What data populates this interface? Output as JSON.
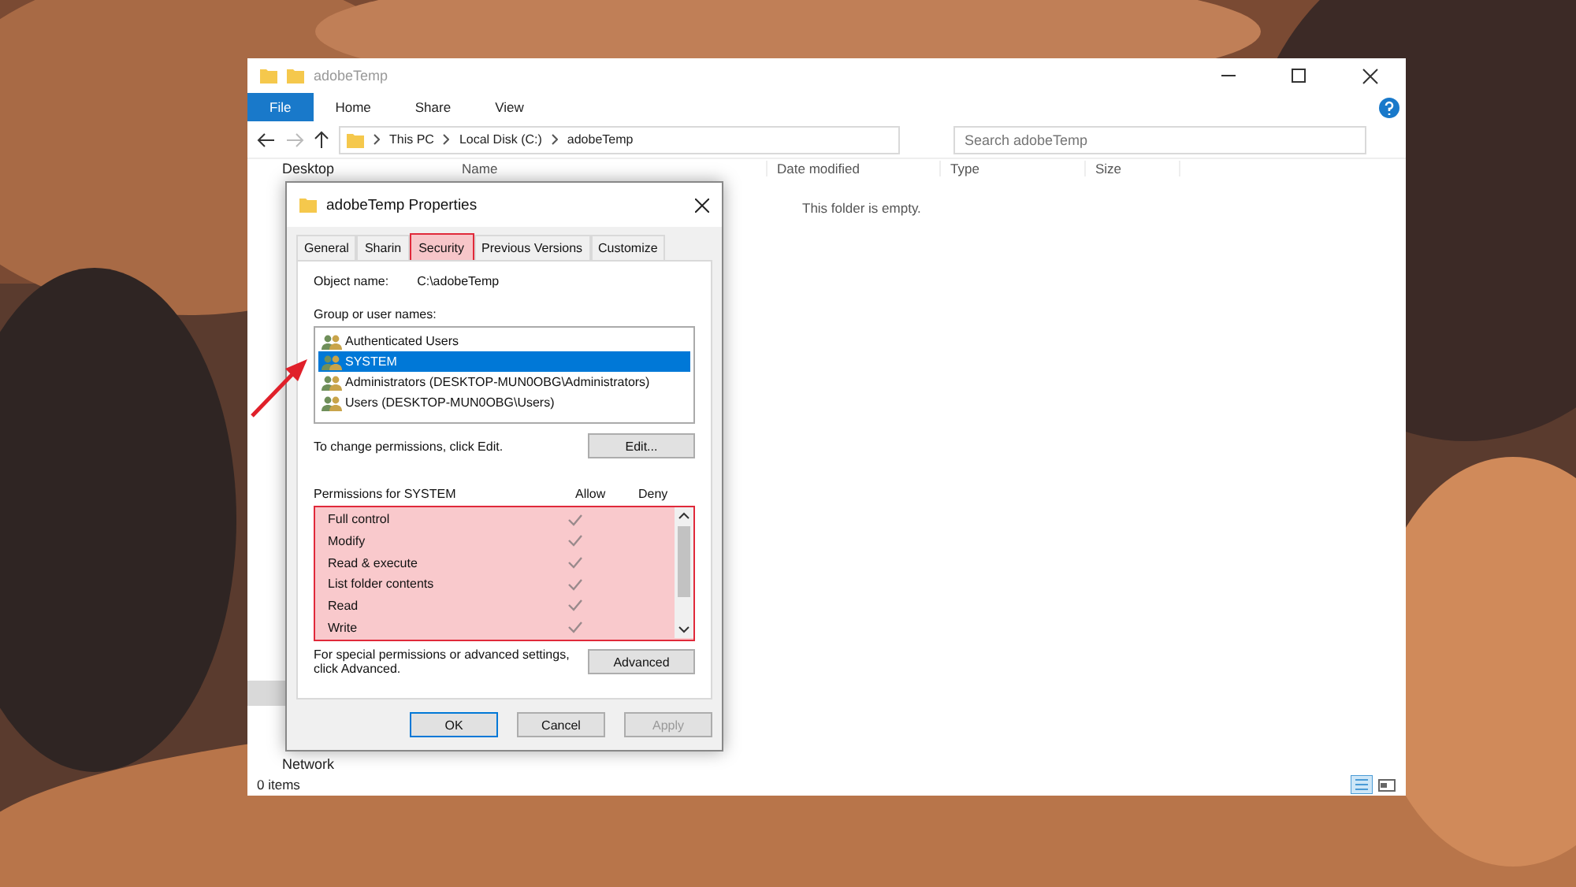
{
  "explorer": {
    "title": "adobeTemp",
    "ribbon_tabs": [
      {
        "label": "File",
        "selected": true
      },
      {
        "label": "Home",
        "selected": false
      },
      {
        "label": "Share",
        "selected": false
      },
      {
        "label": "View",
        "selected": false
      }
    ],
    "breadcrumbs": [
      "This PC",
      "Local Disk (C:)",
      "adobeTemp"
    ],
    "search": {
      "placeholder": "Search adobeTemp"
    },
    "nav_items": [
      {
        "label": "Desktop",
        "selected": false
      },
      {
        "selected": true
      },
      {
        "label": "Network",
        "selected": false
      }
    ],
    "columns": [
      "Name",
      "Date modified",
      "Type",
      "Size"
    ],
    "empty_message": "This folder is empty.",
    "status": "0 items"
  },
  "dialog": {
    "title": "adobeTemp Properties",
    "tabs": [
      {
        "label": "General",
        "selected": false
      },
      {
        "label": "Sharin",
        "selected": false
      },
      {
        "label": "Security",
        "selected": true
      },
      {
        "label": "Previous Versions",
        "selected": false
      },
      {
        "label": "Customize",
        "selected": false
      }
    ],
    "object_label": "Object name:",
    "object_value": "C:\\adobeTemp",
    "group_label": "Group or user names:",
    "users": [
      {
        "name": "Authenticated Users",
        "selected": false
      },
      {
        "name": "SYSTEM",
        "selected": true
      },
      {
        "name": "Administrators (DESKTOP-MUN0OBG\\Administrators)",
        "selected": false
      },
      {
        "name": "Users (DESKTOP-MUN0OBG\\Users)",
        "selected": false
      }
    ],
    "edit_hint": "To change permissions, click Edit.",
    "edit_button": "Edit...",
    "permissions_label": "Permissions for SYSTEM",
    "allow_label": "Allow",
    "deny_label": "Deny",
    "permissions": [
      {
        "name": "Full control",
        "allow": true,
        "deny": false
      },
      {
        "name": "Modify",
        "allow": true,
        "deny": false
      },
      {
        "name": "Read & execute",
        "allow": true,
        "deny": false
      },
      {
        "name": "List folder contents",
        "allow": true,
        "deny": false
      },
      {
        "name": "Read",
        "allow": true,
        "deny": false
      },
      {
        "name": "Write",
        "allow": true,
        "deny": false
      }
    ],
    "advanced_hint": "For special permissions or advanced settings, click Advanced.",
    "advanced_button": "Advanced",
    "buttons": [
      {
        "label": "OK",
        "kind": "default",
        "disabled": false
      },
      {
        "label": "Cancel",
        "kind": "normal",
        "disabled": false
      },
      {
        "label": "Apply",
        "kind": "normal",
        "disabled": true
      }
    ]
  }
}
